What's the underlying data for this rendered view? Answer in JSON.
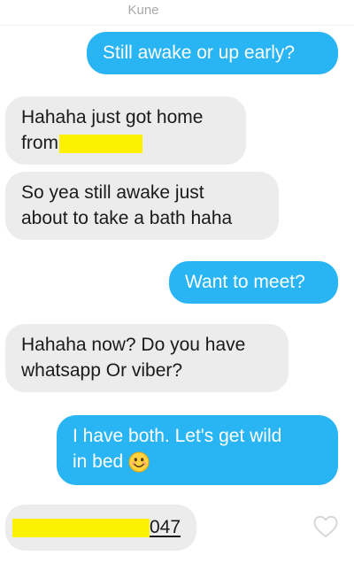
{
  "header": {
    "match_name": "Kune"
  },
  "messages": [
    {
      "direction": "outgoing",
      "text": "Still awake or up early?"
    },
    {
      "direction": "incoming",
      "line1": "Hahaha just got home",
      "line2": "from"
    },
    {
      "direction": "incoming",
      "line1": "So yea still awake just",
      "line2": "about to take a bath haha"
    },
    {
      "direction": "outgoing",
      "text": "Want to meet?"
    },
    {
      "direction": "incoming",
      "line1": "Hahaha now? Do you have",
      "line2": "whatsapp Or viber?"
    },
    {
      "direction": "outgoing",
      "line1": "I have both.  Let's get wild",
      "line2": "in bed"
    },
    {
      "direction": "incoming",
      "text": "047"
    }
  ],
  "icons": {
    "redaction_color": "#fbf100",
    "emoji": "smiling-face-icon",
    "like": "heart-outline-icon"
  },
  "colors": {
    "outgoing_bubble": "#29b5f3",
    "incoming_bubble": "#ececec"
  }
}
